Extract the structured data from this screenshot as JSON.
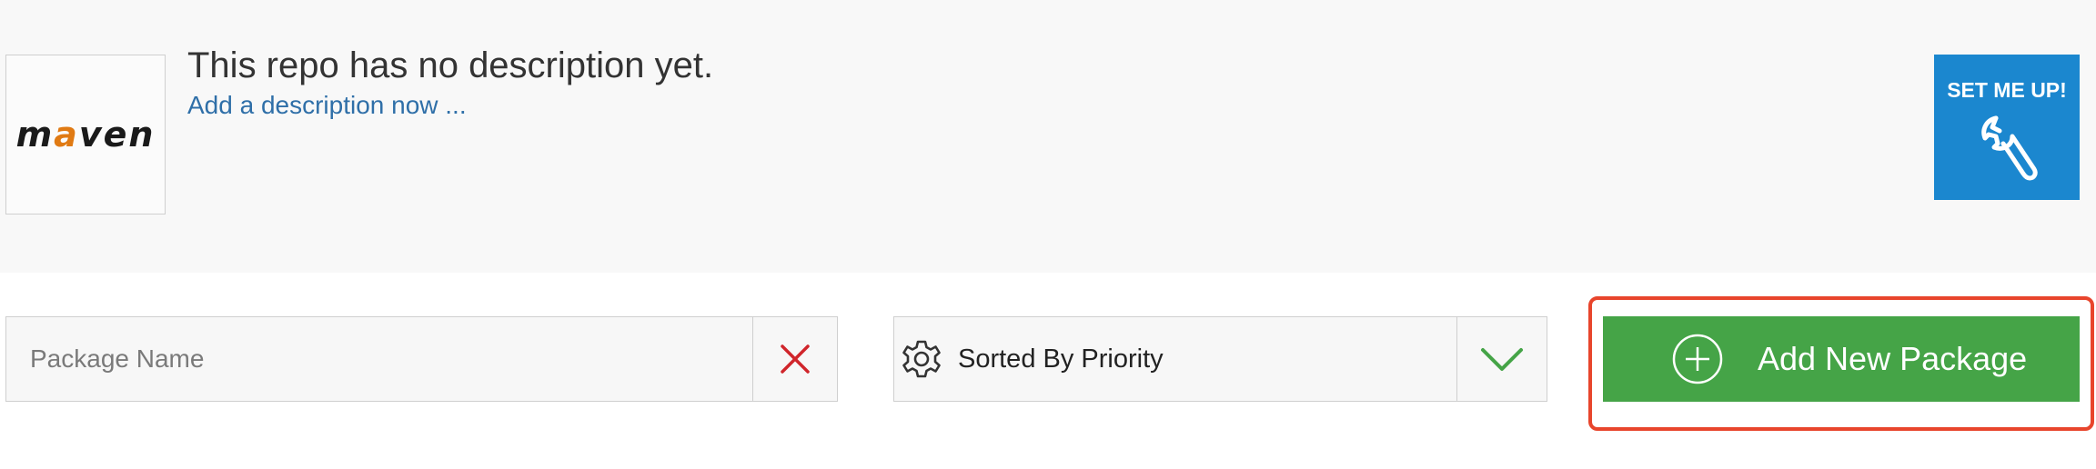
{
  "repo": {
    "logo_text_prefix": "m",
    "logo_text_accent": "a",
    "logo_text_suffix": "ven",
    "description": "This repo has no description yet.",
    "add_description_link": "Add a description now ..."
  },
  "setup": {
    "label": "SET ME UP!",
    "icon": "wrench-icon"
  },
  "search": {
    "placeholder": "Package Name",
    "value": "",
    "clear_icon": "close-icon",
    "clear_color": "#d0252b"
  },
  "sort": {
    "label": "Sorted By Priority",
    "icon": "gear-icon",
    "toggle_icon": "chevron-down-icon",
    "toggle_color": "#45a447"
  },
  "actions": {
    "add_package_label": "Add New Package",
    "add_package_icon": "plus-circle-icon"
  },
  "colors": {
    "setup_blue": "#1b87cf",
    "add_green": "#45a447",
    "highlight_red": "#e8452c",
    "link_blue": "#2f6fa8",
    "logo_accent": "#e07a13"
  }
}
